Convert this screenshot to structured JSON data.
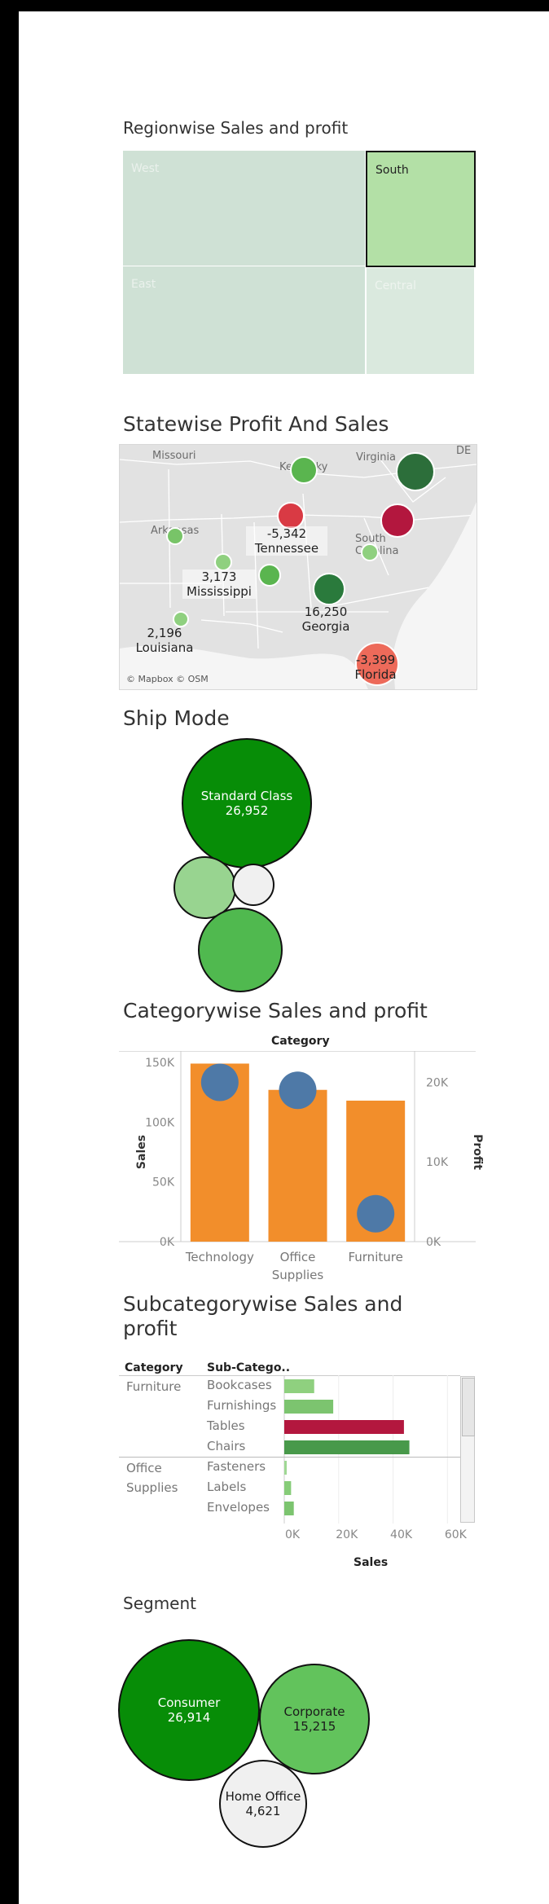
{
  "regionwise": {
    "title": "Regionwise Sales and profit",
    "regions": [
      {
        "name": "West",
        "color": "#cfe1d5",
        "text_color": "#eaf1ec"
      },
      {
        "name": "South",
        "color": "#b3e0a6",
        "text_color": "#222222"
      },
      {
        "name": "East",
        "color": "#cfe1d5",
        "text_color": "#eaf1ec"
      },
      {
        "name": "Central",
        "color": "#dae9de",
        "text_color": "#eef4ef"
      }
    ]
  },
  "statewise": {
    "title": "Statewise Profit And Sales",
    "background_states": [
      "Missouri",
      "Kentucky",
      "Virginia",
      "DE",
      "Tennessee",
      "Arkansas",
      "Mississippi",
      "South Carolina",
      "Louisiana",
      "Georgia"
    ],
    "labels": [
      {
        "value": "-5,342",
        "state": "Tennessee"
      },
      {
        "value": "3,173",
        "state": "Mississippi"
      },
      {
        "value": "16,250",
        "state": "Georgia"
      },
      {
        "value": "2,196",
        "state": "Louisiana"
      },
      {
        "value": "-3,399",
        "state": "Florida"
      }
    ],
    "attribution": "© Mapbox © OSM"
  },
  "ship_mode": {
    "title": "Ship Mode",
    "bubbles": [
      {
        "label": "Standard Class",
        "value": "26,952",
        "color": "#078d07"
      },
      {
        "label": "",
        "value": "",
        "color": "#98d490"
      },
      {
        "label": "",
        "value": "",
        "color": "#f0f0f0"
      },
      {
        "label": "",
        "value": "",
        "color": "#50b94f"
      }
    ]
  },
  "category": {
    "title": "Categorywise Sales and profit",
    "header": "Category",
    "left_axis_title": "Sales",
    "right_axis_title": "Profit",
    "left_ticks": [
      "150K",
      "100K",
      "50K",
      "0K"
    ],
    "right_ticks": [
      "20K",
      "10K",
      "0K"
    ],
    "categories": [
      "Technology",
      "Office Supplies",
      "Furniture"
    ],
    "category_lines": [
      [
        "Technology"
      ],
      [
        "Office",
        "Supplies"
      ],
      [
        "Furniture"
      ]
    ],
    "bar_color": "#f28e2b",
    "dot_color": "#4e79a7"
  },
  "subcategory": {
    "title_line1": "Subcategorywise Sales and",
    "title_line2": "profit",
    "headers": {
      "category": "Category",
      "subcategory": "Sub-Catego.."
    },
    "groups": [
      {
        "category_lines": [
          "Furniture"
        ],
        "rows": [
          {
            "name": "Bookcases",
            "color": "#8fd07f"
          },
          {
            "name": "Furnishings",
            "color": "#7cc46f"
          },
          {
            "name": "Tables",
            "color": "#b3173e"
          },
          {
            "name": "Chairs",
            "color": "#48994a"
          }
        ]
      },
      {
        "category_lines": [
          "Office",
          "Supplies"
        ],
        "rows": [
          {
            "name": "Fasteners",
            "color": "#9fd894"
          },
          {
            "name": "Labels",
            "color": "#86cc78"
          },
          {
            "name": "Envelopes",
            "color": "#7cc46f"
          }
        ]
      }
    ],
    "x_ticks": [
      "0K",
      "20K",
      "40K",
      "60K"
    ],
    "x_title": "Sales"
  },
  "segment": {
    "title": "Segment",
    "bubbles": [
      {
        "label": "Consumer",
        "value": "26,914",
        "color": "#078d07",
        "text_color": "#ffffff"
      },
      {
        "label": "Corporate",
        "value": "15,215",
        "color": "#62c35c",
        "text_color": "#1b1b1b"
      },
      {
        "label": "Home Office",
        "value": "4,621",
        "color": "#f0f0f0",
        "text_color": "#1b1b1b"
      }
    ]
  },
  "chart_data": [
    {
      "type": "bar",
      "title": "Categorywise Sales and profit",
      "categories": [
        "Technology",
        "Office Supplies",
        "Furniture"
      ],
      "series": [
        {
          "name": "Sales",
          "values": [
            149000,
            127000,
            118000
          ]
        },
        {
          "name": "Profit",
          "values": [
            20000,
            19000,
            3500
          ]
        }
      ],
      "xlabel": "Category",
      "ylabel": "Sales",
      "y2label": "Profit",
      "ylim": [
        0,
        150000
      ],
      "y2lim": [
        0,
        22500
      ],
      "grid": false
    },
    {
      "type": "bar",
      "title": "Subcategorywise Sales and profit",
      "categories": [
        "Bookcases",
        "Furnishings",
        "Tables",
        "Chairs",
        "Fasteners",
        "Labels",
        "Envelopes"
      ],
      "values": [
        11000,
        18000,
        44000,
        46000,
        700,
        2500,
        3500
      ],
      "xlabel": "Sales",
      "ylabel": "",
      "xlim": [
        0,
        62000
      ],
      "orientation": "horizontal",
      "grid": true
    }
  ]
}
